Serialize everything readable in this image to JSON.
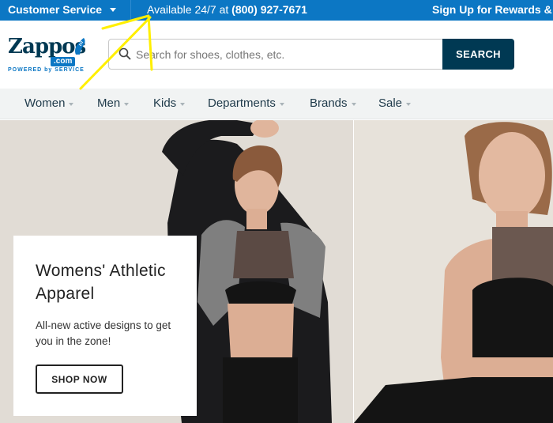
{
  "topbar": {
    "customer_service": "Customer Service",
    "availability_prefix": "Available 24/7 at",
    "phone": "(800) 927-7671",
    "rewards": "Sign Up for Rewards &"
  },
  "logo": {
    "name": "Zappos",
    "com": ".com",
    "tagline": "POWERED by SERVICE"
  },
  "search": {
    "placeholder": "Search for shoes, clothes, etc.",
    "value": "",
    "button_label": "SEARCH"
  },
  "nav": {
    "items": [
      {
        "label": "Women"
      },
      {
        "label": "Men"
      },
      {
        "label": "Kids"
      },
      {
        "label": "Departments"
      },
      {
        "label": "Brands"
      },
      {
        "label": "Sale"
      }
    ]
  },
  "hero": {
    "title": "Womens' Athletic Apparel",
    "text": "All-new active designs to get you in the zone!",
    "button_label": "SHOP NOW"
  },
  "colors": {
    "topbar": "#0c77c4",
    "brand_navy": "#003953",
    "nav_bg": "#f1f3f3",
    "annotation": "#ffef00"
  },
  "icons": [
    "chevron-down-icon",
    "search-icon",
    "shoe-icon"
  ]
}
